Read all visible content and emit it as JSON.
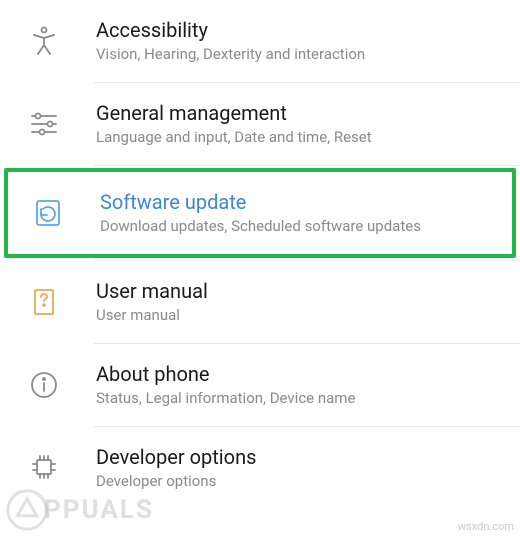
{
  "settings": [
    {
      "id": "accessibility",
      "title": "Accessibility",
      "subtitle": "Vision, Hearing, Dexterity and interaction",
      "icon": "accessibility-icon",
      "highlighted": false
    },
    {
      "id": "general-management",
      "title": "General management",
      "subtitle": "Language and input, Date and time, Reset",
      "icon": "sliders-icon",
      "highlighted": false
    },
    {
      "id": "software-update",
      "title": "Software update",
      "subtitle": "Download updates, Scheduled software updates",
      "icon": "update-icon",
      "highlighted": true
    },
    {
      "id": "user-manual",
      "title": "User manual",
      "subtitle": "User manual",
      "icon": "manual-icon",
      "highlighted": false
    },
    {
      "id": "about-phone",
      "title": "About phone",
      "subtitle": "Status, Legal information, Device name",
      "icon": "info-icon",
      "highlighted": false
    },
    {
      "id": "developer-options",
      "title": "Developer options",
      "subtitle": "Developer options",
      "icon": "developer-icon",
      "highlighted": false
    }
  ],
  "watermarks": {
    "left": "PPUALS",
    "right": "wsxdn.com"
  },
  "colors": {
    "highlight": "#24b64a",
    "highlight_icon": "#5aa7e6",
    "accent_orange": "#e8a854",
    "text_primary": "#1a1a1a",
    "text_secondary": "#8a8a8a"
  }
}
